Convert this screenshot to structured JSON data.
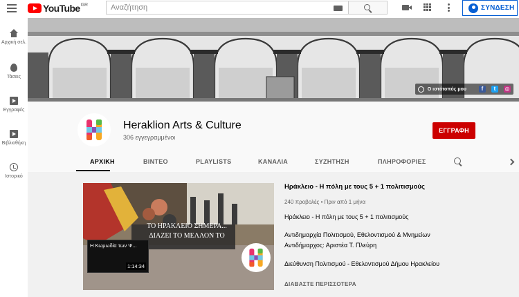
{
  "header": {
    "logo_text": "YouTube",
    "logo_country": "GR",
    "search_placeholder": "Αναζήτηση",
    "signin_label": "ΣΥΝΔΕΣΗ",
    "icons": [
      "menu-icon",
      "keyboard-icon",
      "search-icon",
      "create-video-icon",
      "apps-icon",
      "more-vert-icon",
      "account-icon"
    ]
  },
  "sidebar": {
    "items": [
      {
        "label": "Αρχική σελ.",
        "icon": "home-icon"
      },
      {
        "label": "Τάσεις",
        "icon": "fire-icon"
      },
      {
        "label": "Εγγραφές",
        "icon": "subscriptions-icon"
      },
      {
        "label": "Βιβλιοθήκη",
        "icon": "library-icon"
      },
      {
        "label": "Ιστορικό",
        "icon": "history-icon"
      }
    ]
  },
  "banner": {
    "site_link_label": "Ο ιστότοπός μου",
    "social_icons": [
      "facebook-icon",
      "twitter-icon",
      "instagram-icon"
    ]
  },
  "channel": {
    "name": "Heraklion Arts & Culture",
    "subscribers": "306 εγγεγραμμένοι",
    "subscribe_label": "ΕΓΓΡΑΦΗ"
  },
  "tabs": [
    {
      "label": "ΑΡΧΙΚΗ",
      "active": true
    },
    {
      "label": "ΒΙΝΤΕΟ",
      "active": false
    },
    {
      "label": "PLAYLISTS",
      "active": false
    },
    {
      "label": "ΚΑΝΑΛΙΑ",
      "active": false
    },
    {
      "label": "ΣΥΖΗΤΗΣΗ",
      "active": false
    },
    {
      "label": "ΠΛΗΡΟΦΟΡΙΕΣ",
      "active": false
    }
  ],
  "featured": {
    "thumb_caption_line1": "ΤΟ ΗΡΑΚΛΕΙΟ ΣΗΜΕΡΑ...",
    "thumb_caption_line2": "ΔΙΑΖΕΙ ΤΟ ΜΕΛΛΟΝ ΤΟ",
    "mini_title": "Η Κωμωδία των Ψ...",
    "mini_duration": "1:14:34",
    "title": "Ηράκλειο - Η πόλη με τους 5 + 1 πολιτισμούς",
    "meta": "240 προβολές • Πριν από 1 μήνα",
    "desc": [
      "Ηράκλειο - Η πόλη με τους 5 + 1 πολιτισμούς",
      "Αντιδημαρχία Πολιτισμού, Εθελοντισμού & Μνημείων",
      "Αντιδήμαρχος:  Αριστέα Τ. Πλεύρη",
      "Διεύθυνση Πολιτισμού - Εθελοντισμού Δήμου Ηρακλείου"
    ],
    "read_more": "ΔΙΑΒΑΣΤΕ ΠΕΡΙΣΣΟΤΕΡΑ"
  },
  "colors": {
    "brand_red": "#ff0000",
    "subscribe_red": "#cc0000",
    "link_blue": "#065fd4"
  }
}
